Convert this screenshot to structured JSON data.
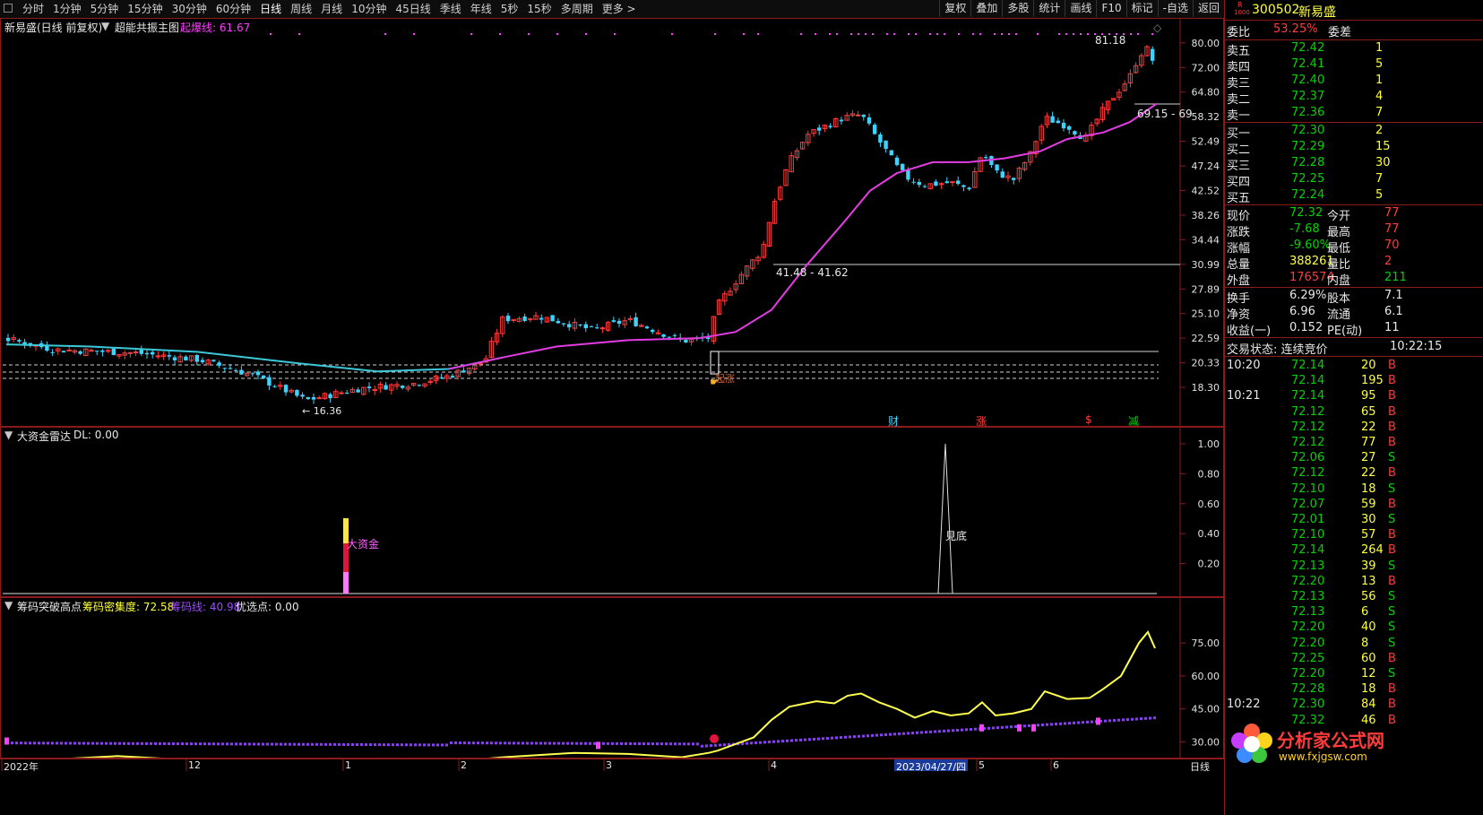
{
  "toolbar": {
    "tabs": [
      "分时",
      "1分钟",
      "5分钟",
      "15分钟",
      "30分钟",
      "60分钟",
      "日线",
      "周线",
      "月线",
      "10分钟",
      "45日线",
      "季线",
      "年线",
      "5秒",
      "15秒",
      "多周期",
      "更多 >"
    ],
    "active_tab": "日线",
    "buttons": [
      "复权",
      "叠加",
      "多股",
      "统计",
      "画线",
      "F10",
      "标记",
      "-自选",
      "返回"
    ]
  },
  "main_chart": {
    "stock_label": "新易盛(日线 前复权)",
    "indicator_name": "超能共振主图",
    "line_label": "起爆线: 61.67",
    "y_ticks": [
      "80.00",
      "72.00",
      "64.80",
      "58.32",
      "52.49",
      "47.24",
      "42.52",
      "38.26",
      "34.44",
      "30.99",
      "27.89",
      "25.10",
      "22.59",
      "20.33",
      "18.30"
    ],
    "high_label": "81.18",
    "range_label_1": "69.15 - 69",
    "range_label_2": "41.48 - 41.62",
    "low_label": "← 16.36",
    "signal_label": "起涨",
    "event_markers": [
      "财",
      "涨",
      "$",
      "减"
    ],
    "colors": {
      "up": "#ff3b3b",
      "down": "#3cd4ff",
      "ma": "#e23ce2",
      "ma_early": "#3cc8d8"
    }
  },
  "indicator1": {
    "title": "大资金雷达",
    "value_label": "DL: 0.00",
    "y_ticks": [
      "1.00",
      "0.80",
      "0.60",
      "0.40",
      "0.20"
    ],
    "bar_label": "大资金",
    "peak_label": "見底"
  },
  "indicator2": {
    "title": "筹码突破高点",
    "concentration_label": "筹码密集度: 72.58",
    "chip_label": "筹码线: 40.98",
    "pick_label": "优选点: 0.00",
    "y_ticks": [
      "75.00",
      "60.00",
      "45.00",
      "30.00"
    ]
  },
  "x_axis": {
    "labels": [
      "2022年",
      "12",
      "1",
      "2",
      "3",
      "4",
      "2023/04/27/四",
      "5",
      "6"
    ],
    "period": "日线"
  },
  "quote": {
    "code": "300502",
    "name": "新易盛",
    "badge": "R",
    "weibi_label": "委比",
    "weibi": "53.25%",
    "weicha_label": "委差",
    "asks": [
      {
        "label": "卖五",
        "price": "72.42",
        "vol": "1"
      },
      {
        "label": "卖四",
        "price": "72.41",
        "vol": "5"
      },
      {
        "label": "卖三",
        "price": "72.40",
        "vol": "1"
      },
      {
        "label": "卖二",
        "price": "72.37",
        "vol": "4"
      },
      {
        "label": "卖一",
        "price": "72.36",
        "vol": "7"
      }
    ],
    "bids": [
      {
        "label": "买一",
        "price": "72.30",
        "vol": "2"
      },
      {
        "label": "买二",
        "price": "72.29",
        "vol": "15"
      },
      {
        "label": "买三",
        "price": "72.28",
        "vol": "30"
      },
      {
        "label": "买四",
        "price": "72.25",
        "vol": "7"
      },
      {
        "label": "买五",
        "price": "72.24",
        "vol": "5"
      }
    ],
    "stats": [
      {
        "l1": "现价",
        "v1": "72.32",
        "l2": "今开",
        "v2": "77"
      },
      {
        "l1": "涨跌",
        "v1": "-7.68",
        "l2": "最高",
        "v2": "77"
      },
      {
        "l1": "涨幅",
        "v1": "-9.60%",
        "l2": "最低",
        "v2": "70"
      },
      {
        "l1": "总量",
        "v1": "388261",
        "l2": "量比",
        "v2": "2"
      },
      {
        "l1": "外盘",
        "v1": "176574",
        "l2": "内盘",
        "v2": "211"
      }
    ],
    "stats2": [
      {
        "l1": "换手",
        "v1": "6.29%",
        "l2": "股本",
        "v2": "7.1"
      },
      {
        "l1": "净资",
        "v1": "6.96",
        "l2": "流通",
        "v2": "6.1"
      },
      {
        "l1": "收益(一)",
        "v1": "0.152",
        "l2": "PE(动)",
        "v2": "11"
      }
    ],
    "trade_status": "交易状态: 连续竞价",
    "trade_time": "10:22:15"
  },
  "ticks": [
    {
      "t": "10:20",
      "p": "72.14",
      "v": "20",
      "s": "B"
    },
    {
      "t": "",
      "p": "72.14",
      "v": "195",
      "s": "B"
    },
    {
      "t": "10:21",
      "p": "72.14",
      "v": "95",
      "s": "B"
    },
    {
      "t": "",
      "p": "72.12",
      "v": "65",
      "s": "B"
    },
    {
      "t": "",
      "p": "72.12",
      "v": "22",
      "s": "B"
    },
    {
      "t": "",
      "p": "72.12",
      "v": "77",
      "s": "B"
    },
    {
      "t": "",
      "p": "72.06",
      "v": "27",
      "s": "S"
    },
    {
      "t": "",
      "p": "72.12",
      "v": "22",
      "s": "B"
    },
    {
      "t": "",
      "p": "72.10",
      "v": "18",
      "s": "S"
    },
    {
      "t": "",
      "p": "72.07",
      "v": "59",
      "s": "B"
    },
    {
      "t": "",
      "p": "72.01",
      "v": "30",
      "s": "S"
    },
    {
      "t": "",
      "p": "72.10",
      "v": "57",
      "s": "B"
    },
    {
      "t": "",
      "p": "72.14",
      "v": "264",
      "s": "B"
    },
    {
      "t": "",
      "p": "72.13",
      "v": "39",
      "s": "S"
    },
    {
      "t": "",
      "p": "72.20",
      "v": "13",
      "s": "B"
    },
    {
      "t": "",
      "p": "72.13",
      "v": "56",
      "s": "S"
    },
    {
      "t": "",
      "p": "72.13",
      "v": "6",
      "s": "S"
    },
    {
      "t": "",
      "p": "72.20",
      "v": "40",
      "s": "S"
    },
    {
      "t": "",
      "p": "72.20",
      "v": "8",
      "s": "S"
    },
    {
      "t": "",
      "p": "72.25",
      "v": "60",
      "s": "B"
    },
    {
      "t": "",
      "p": "72.20",
      "v": "12",
      "s": "S"
    },
    {
      "t": "",
      "p": "72.28",
      "v": "18",
      "s": "B"
    },
    {
      "t": "10:22",
      "p": "72.30",
      "v": "84",
      "s": "B"
    },
    {
      "t": "",
      "p": "72.32",
      "v": "46",
      "s": "B"
    }
  ],
  "watermark": {
    "text": "分析家公式网",
    "url": "www.fxjgsw.com"
  }
}
